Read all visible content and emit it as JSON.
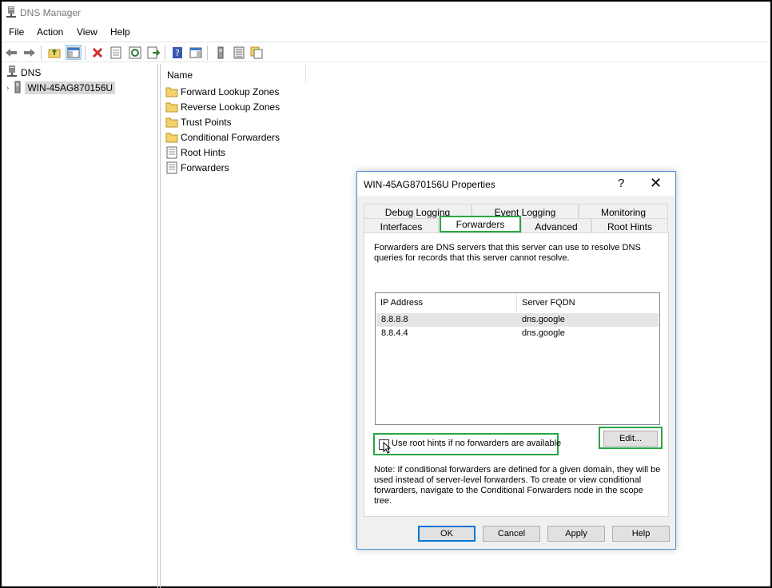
{
  "window": {
    "title": "DNS Manager"
  },
  "menu": [
    "File",
    "Action",
    "View",
    "Help"
  ],
  "tree": {
    "root_label": "DNS",
    "server_label": "WIN-45AG870156U"
  },
  "list": {
    "column_name": "Name",
    "items": [
      {
        "label": "Forward Lookup Zones",
        "icon": "folder-icon"
      },
      {
        "label": "Reverse Lookup Zones",
        "icon": "folder-icon"
      },
      {
        "label": "Trust Points",
        "icon": "folder-icon"
      },
      {
        "label": "Conditional Forwarders",
        "icon": "folder-icon"
      },
      {
        "label": "Root Hints",
        "icon": "document-icon"
      },
      {
        "label": "Forwarders",
        "icon": "document-icon"
      }
    ]
  },
  "dialog": {
    "title": "WIN-45AG870156U Properties",
    "help_glyph": "?",
    "close_glyph": "✕",
    "tabs_row1": [
      "Debug Logging",
      "Event Logging",
      "Monitoring"
    ],
    "tabs_row2": [
      "Interfaces",
      "Forwarders",
      "Advanced",
      "Root Hints"
    ],
    "active_tab": "Forwarders",
    "description": "Forwarders are DNS servers that this server can use to resolve DNS queries for records that this server cannot resolve.",
    "table": {
      "headers": [
        "IP Address",
        "Server FQDN"
      ],
      "rows": [
        [
          "8.8.8.8",
          "dns.google"
        ],
        [
          "8.8.4.4",
          "dns.google"
        ]
      ]
    },
    "checkbox_label": "Use root hints if no forwarders are available",
    "checkbox_checked": false,
    "edit_button": "Edit...",
    "note": "Note: If conditional forwarders are defined for a given domain, they will be used instead of server-level forwarders.  To create or view conditional forwarders, navigate to the Conditional Forwarders node in the scope tree.",
    "buttons": [
      "OK",
      "Cancel",
      "Apply",
      "Help"
    ]
  },
  "colors": {
    "highlight_green": "#28a745",
    "focus_blue": "#0078d7",
    "folder_yellow": "#f5d36b"
  }
}
